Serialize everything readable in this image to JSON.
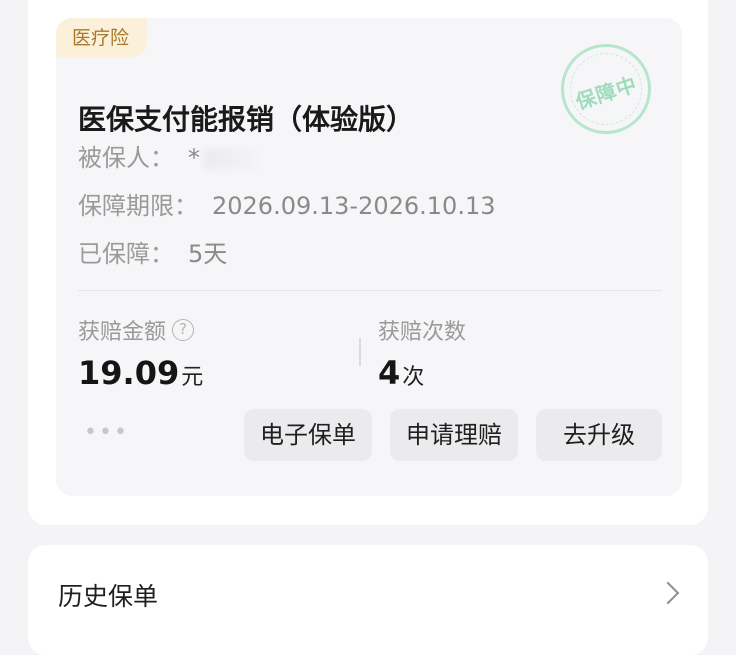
{
  "policy": {
    "type_tag": "医疗险",
    "title": "医保支付能报销（体验版）",
    "stamp": "保障中",
    "insured_label": "被保人：",
    "insured_value": "*",
    "period_label": "保障期限：",
    "period_value": "2026.09.13-2026.10.13",
    "covered_label": "已保障：",
    "covered_value": "5天",
    "claim_amount_label": "获赔金额",
    "claim_amount_value": "19.09",
    "claim_amount_unit": "元",
    "claim_count_label": "获赔次数",
    "claim_count_value": "4",
    "claim_count_unit": "次",
    "more": "•••",
    "actions": {
      "e_policy": "电子保单",
      "claim": "申请理赔",
      "upgrade": "去升级"
    }
  },
  "history": {
    "label": "历史保单"
  },
  "icons": {
    "help": "help-circle-icon",
    "chevron": "chevron-right-icon"
  },
  "colors": {
    "tag_bg": "#fbf1da",
    "tag_text": "#a8792a",
    "stamp": "#9fdcbc"
  }
}
